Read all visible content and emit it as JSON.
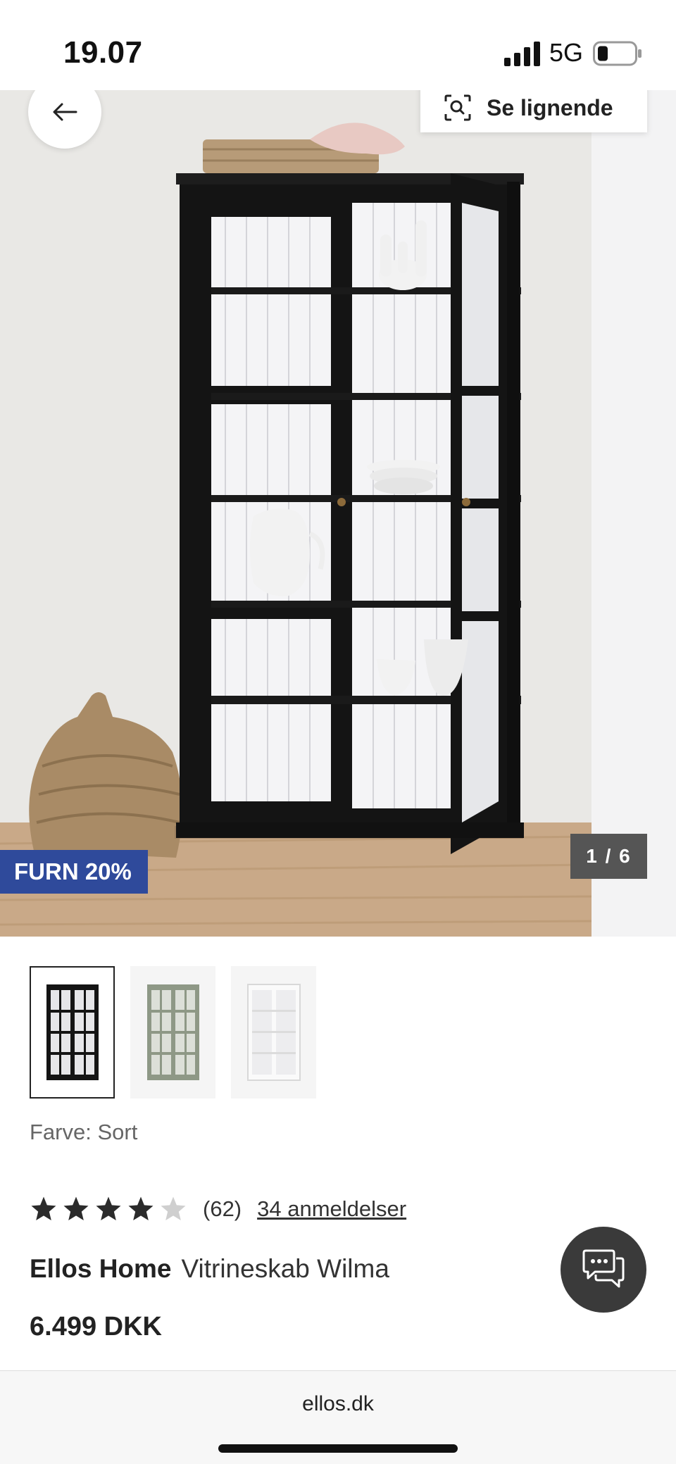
{
  "status_bar": {
    "time": "19.07",
    "network": "5G",
    "signal_icon": "cellular-signal-icon",
    "battery_icon": "battery-low-icon"
  },
  "hero": {
    "back_icon": "arrow-left-icon",
    "similar_label": "Se lignende",
    "similar_icon": "visual-search-icon",
    "promo_badge": "FURN 20%",
    "image_counter": "1 / 6"
  },
  "thumbnails": [
    {
      "name": "black-cabinet",
      "selected": true
    },
    {
      "name": "green-cabinet",
      "selected": false
    },
    {
      "name": "white-cabinet",
      "selected": false
    }
  ],
  "color_label": "Farve: Sort",
  "rating": {
    "stars_filled": 4,
    "stars_total": 5,
    "count": "(62)",
    "reviews_link": "34 anmeldelser"
  },
  "product": {
    "brand": "Ellos Home",
    "name": "Vitrineskab Wilma",
    "price": "6.499 DKK"
  },
  "chat_icon": "chat-bubbles-icon",
  "url_bar": {
    "url": "ellos.dk"
  },
  "colors": {
    "promo": "#2f4a9b",
    "star_filled": "#2b2b2b",
    "star_empty": "#cfcfcf",
    "chat_button": "#3a3a3a"
  }
}
